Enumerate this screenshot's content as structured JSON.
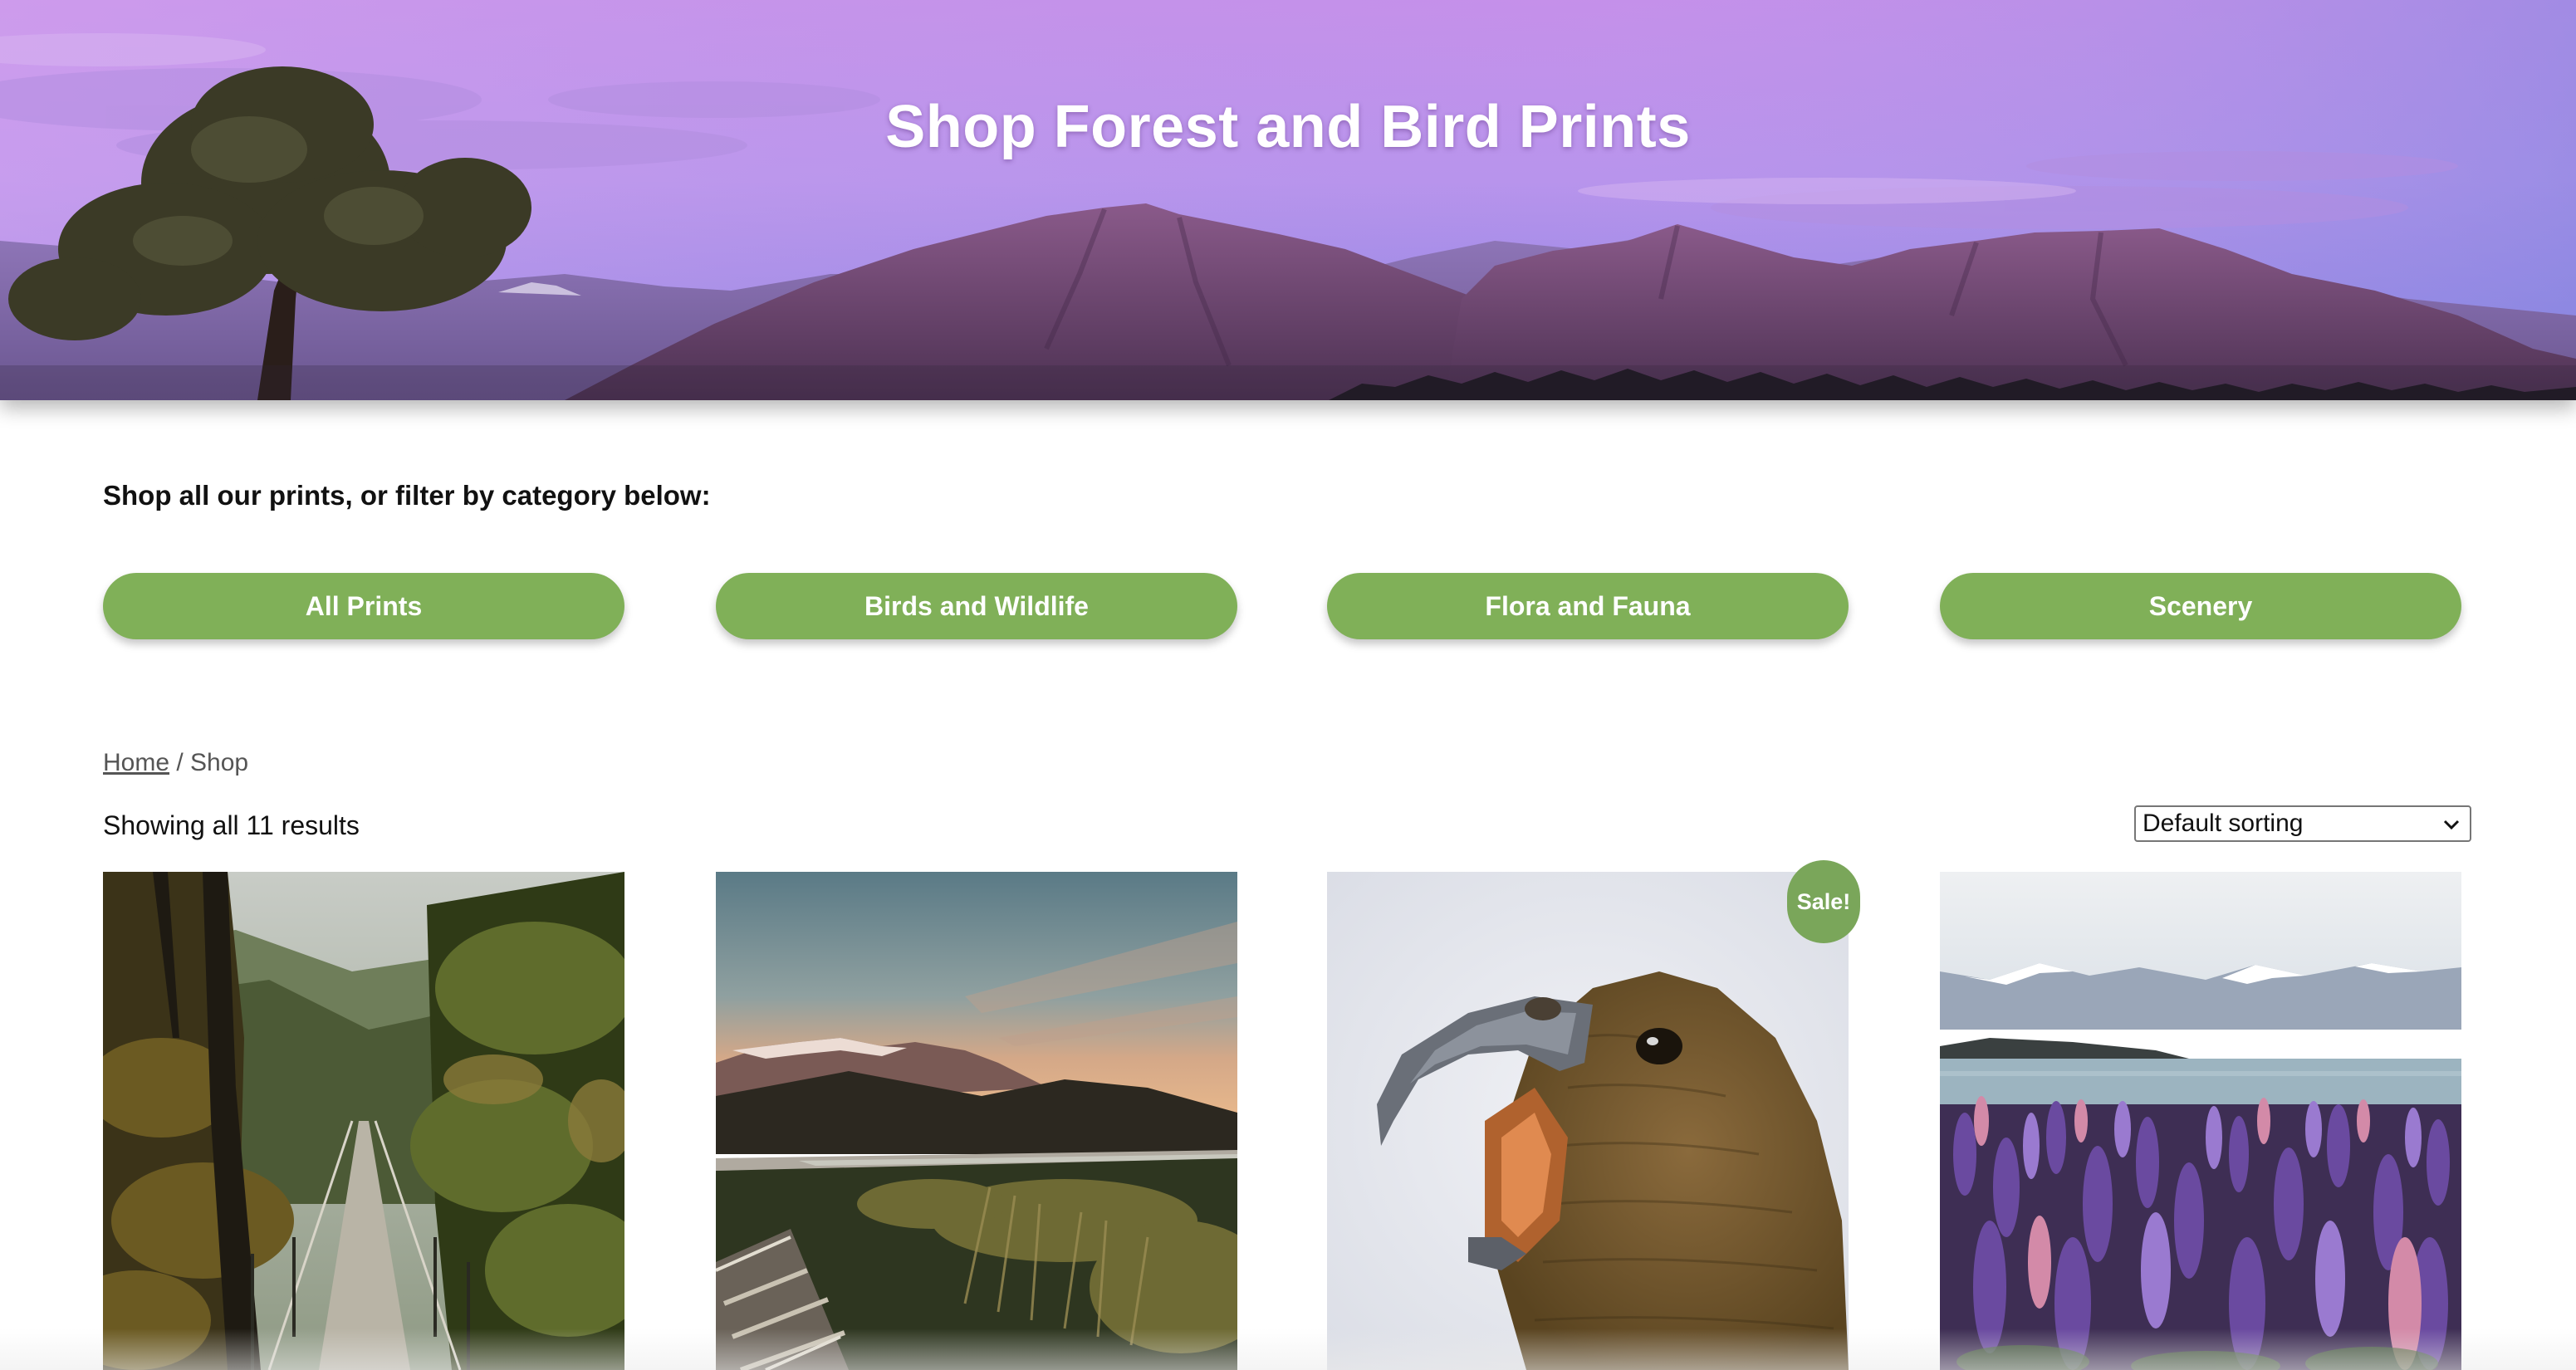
{
  "hero": {
    "title": "Shop Forest and Bird Prints"
  },
  "intro": {
    "text": "Shop all our prints, or filter by category below:"
  },
  "filters": [
    {
      "label": "All Prints"
    },
    {
      "label": "Birds and Wildlife"
    },
    {
      "label": "Flora and Fauna"
    },
    {
      "label": "Scenery"
    }
  ],
  "breadcrumb": {
    "home": "Home",
    "separator": " / ",
    "current": "Shop"
  },
  "results": {
    "text": "Showing all 11 results"
  },
  "sorting": {
    "selected": "Default sorting"
  },
  "products": [
    {
      "image": "swing-bridge-forest-photo",
      "sale": false
    },
    {
      "image": "railway-mountain-sunset-photo",
      "sale": false
    },
    {
      "image": "kea-parrot-photo",
      "sale": true,
      "badge": "Sale!"
    },
    {
      "image": "lupins-lake-tekapo-photo",
      "sale": false
    }
  ],
  "colors": {
    "button_green": "#80b058",
    "sale_green": "#7aa65a",
    "hero_sky_top": "#c592e8",
    "hero_sky_bottom": "#8e86e6"
  }
}
